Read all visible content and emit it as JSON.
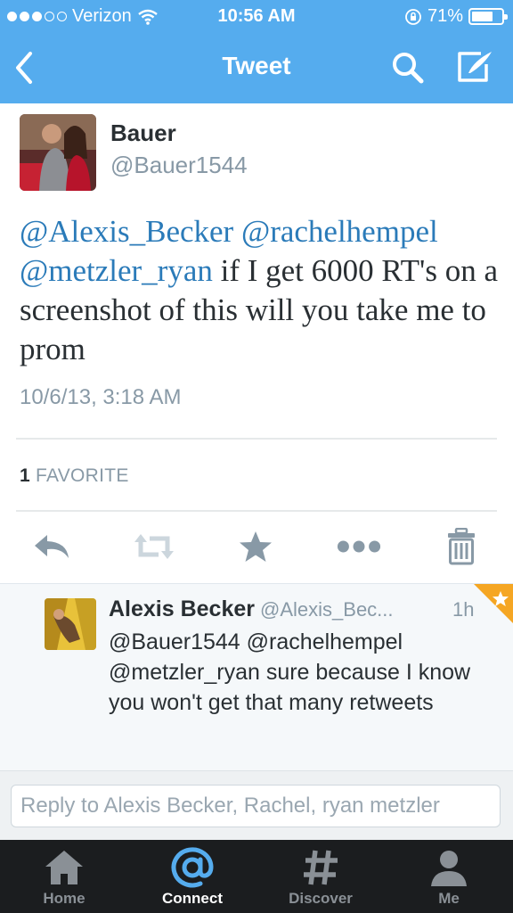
{
  "status_bar": {
    "carrier": "Verizon",
    "time": "10:56 AM",
    "battery": "71%",
    "battery_level": 0.71
  },
  "nav": {
    "title": "Tweet"
  },
  "tweet": {
    "author_name": "Bauer",
    "author_handle": "@Bauer1544",
    "mentions": [
      "@Alexis_Becker",
      "@rachelhempel",
      "@metzler_ryan"
    ],
    "text_line1_end": " ",
    "text_body": " if I get 6000 RT's on a screenshot of this will you take me to prom",
    "date": "10/6/13, 3:18 AM",
    "favorite_count": "1",
    "favorite_label": "FAVORITE"
  },
  "reply": {
    "name": "Alexis Becker",
    "handle": "@Alexis_Bec...",
    "time": "1h",
    "text": "@Bauer1544 @rachelhempel @metzler_ryan sure because I know you won't get that many retweets"
  },
  "reply_box": {
    "placeholder": "Reply to Alexis Becker, Rachel, ryan metzler"
  },
  "tabs": [
    {
      "label": "Home",
      "icon": "home-icon",
      "active": false
    },
    {
      "label": "Connect",
      "icon": "at-icon",
      "active": true
    },
    {
      "label": "Discover",
      "icon": "hashtag-icon",
      "active": false
    },
    {
      "label": "Me",
      "icon": "person-icon",
      "active": false
    }
  ],
  "colors": {
    "brand_blue": "#55acee",
    "mention_blue": "#2b7bb9",
    "favorite_orange": "#f5a623"
  }
}
